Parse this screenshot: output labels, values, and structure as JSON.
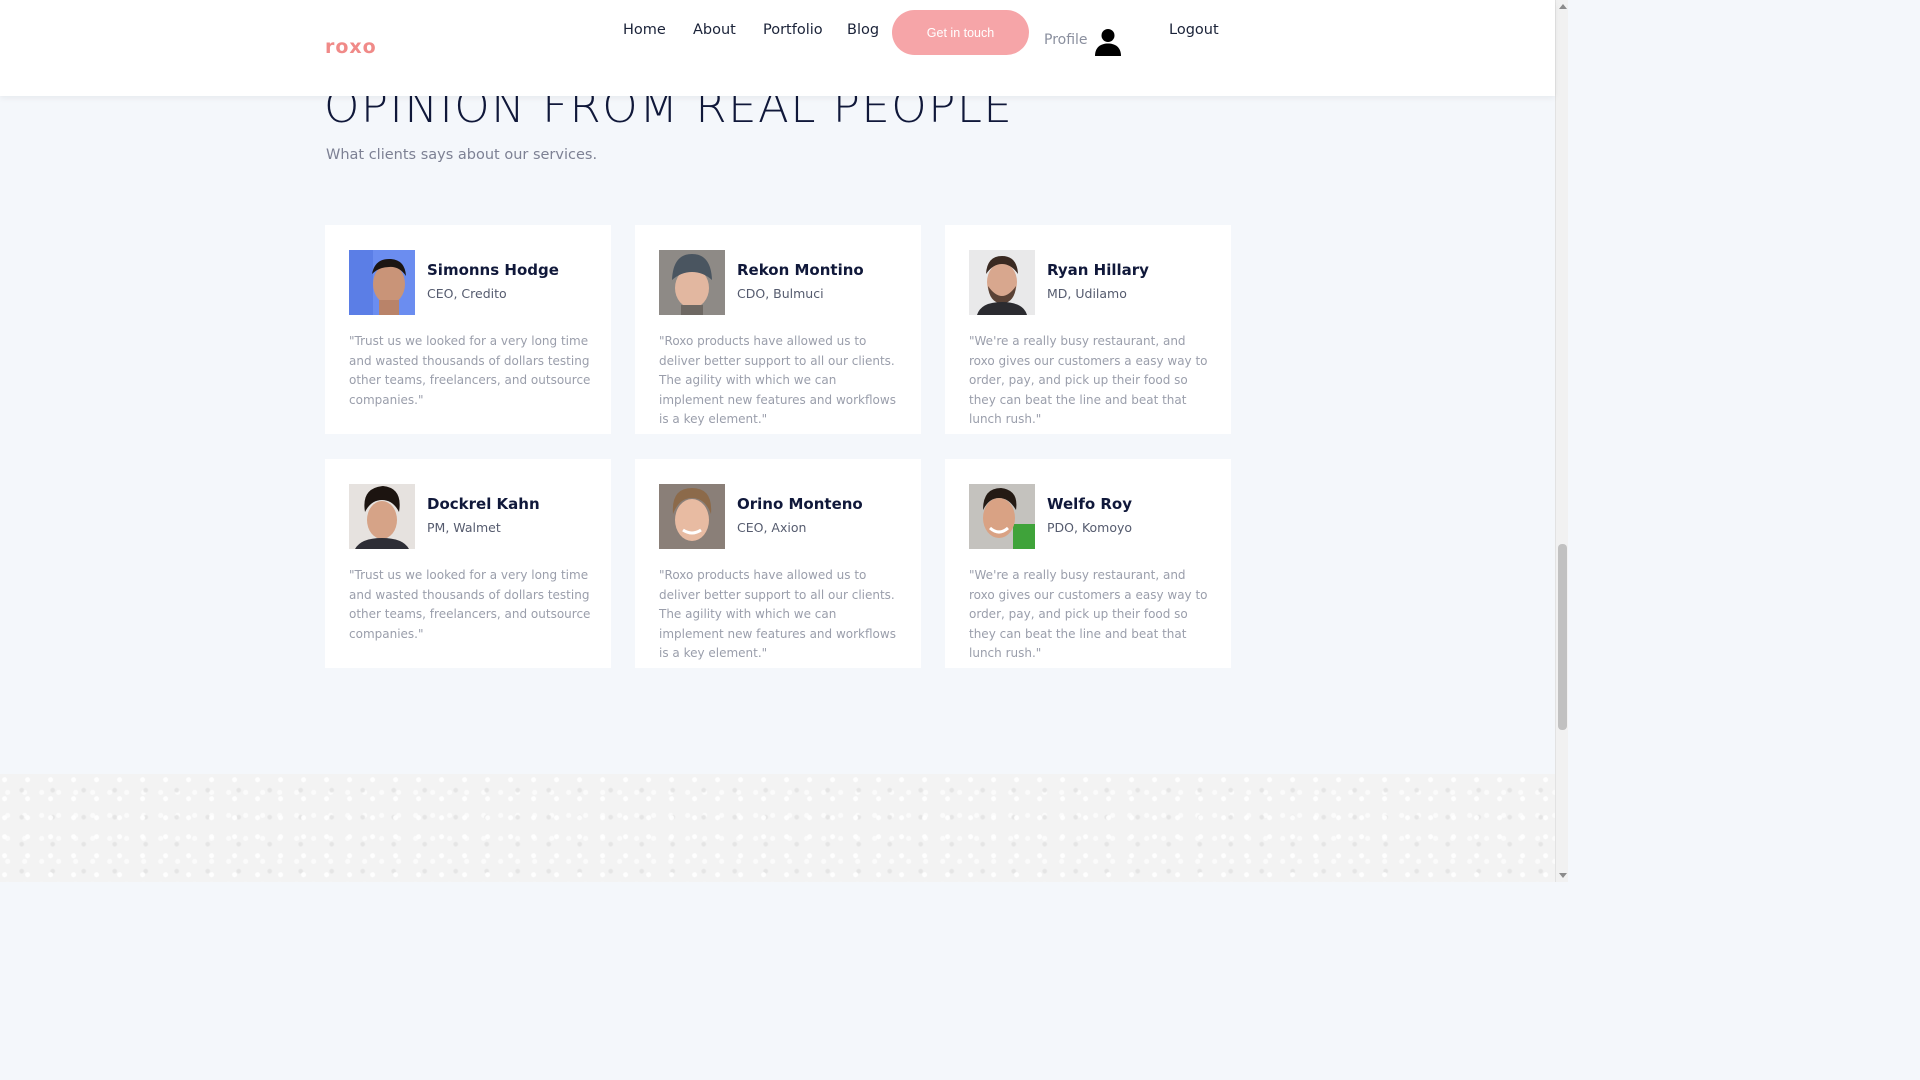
{
  "brand": {
    "logo": "roxo",
    "accent_color": "#f6a5a8"
  },
  "nav": {
    "links": [
      "Home",
      "About",
      "Portfolio",
      "Blog"
    ],
    "cta_label": "Get in touch",
    "profile_label": "Profile",
    "profile_icon": "user-icon",
    "logout_label": "Logout"
  },
  "section": {
    "title": "OPINION FROM REAL PEOPLE",
    "subtitle": "What clients says about our services."
  },
  "testimonials": [
    {
      "name": "Simonns Hodge",
      "role": "CEO, Credito",
      "quote": "\"Trust us we looked for a very long time and wasted thousands of dollars testing other teams, freelancers, and outsource companies.\""
    },
    {
      "name": "Rekon Montino",
      "role": "CDO, Bulmuci",
      "quote": "\"Roxo products have allowed us to deliver better support to all our clients. The agility with which we can implement new features and workflows is a key element.\""
    },
    {
      "name": "Ryan Hillary",
      "role": "MD, Udilamo",
      "quote": "\"We're a really busy restaurant, and roxo gives our customers a easy way to order, pay, and pick up their food so they can beat the line and beat that lunch rush.\""
    },
    {
      "name": "Dockrel Kahn",
      "role": "PM, Walmet",
      "quote": "\"Trust us we looked for a very long time and wasted thousands of dollars testing other teams, freelancers, and outsource companies.\""
    },
    {
      "name": "Orino Monteno",
      "role": "CEO, Axion",
      "quote": "\"Roxo products have allowed us to deliver better support to all our clients. The agility with which we can implement new features and workflows is a key element.\""
    },
    {
      "name": "Welfo Roy",
      "role": "PDO, Komoyo",
      "quote": "\"We're a really busy restaurant, and roxo gives our customers a easy way to order, pay, and pick up their food so they can beat the line and beat that lunch rush.\""
    }
  ]
}
